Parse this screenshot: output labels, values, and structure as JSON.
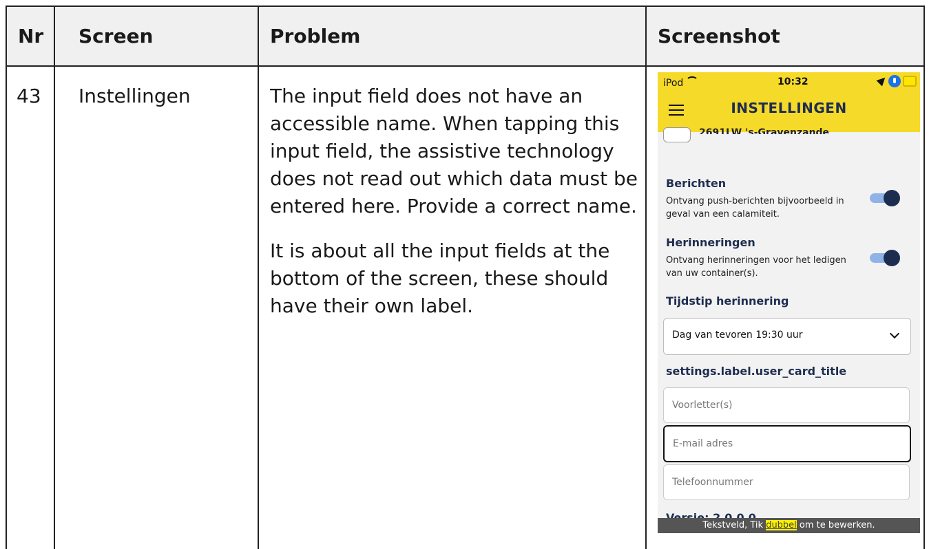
{
  "table": {
    "headers": {
      "nr": "Nr",
      "screen": "Screen",
      "problem": "Problem",
      "screenshot": "Screenshot"
    },
    "row": {
      "nr": "43",
      "screen": "Instellingen",
      "problem_p1": "The input field does not have an accessible name. When tapping this input field, the assistive technology does not read out which data must be entered here. Provide a correct name.",
      "problem_p2": "It is about all the input fields at the bottom of the screen, these should have their own label."
    }
  },
  "phone": {
    "status": {
      "device": "iPod",
      "time": "10:32"
    },
    "title": "INSTELLINGEN",
    "cut_text": "2691LW 's-Gravenzande",
    "berichten": {
      "title": "Berichten",
      "desc": "Ontvang push-berichten bijvoorbeeld in geval van een calamiteit.",
      "on": true
    },
    "herinneringen": {
      "title": "Herinneringen",
      "desc": "Ontvang herinneringen voor het ledigen van uw container(s).",
      "on": true
    },
    "tijdstip": {
      "title": "Tijdstip herinnering",
      "value": "Dag van tevoren 19:30 uur"
    },
    "user_card_title": "settings.label.user_card_title",
    "fields": {
      "initials_placeholder": "Voorletter(s)",
      "email_placeholder": "E-mail adres",
      "phone_placeholder": "Telefoonnummer"
    },
    "version": "Versie: 2.0.0.0",
    "voiceover": {
      "before": "Tekstveld, Tik ",
      "highlight": "dubbel",
      "after": " om te bewerken."
    }
  }
}
